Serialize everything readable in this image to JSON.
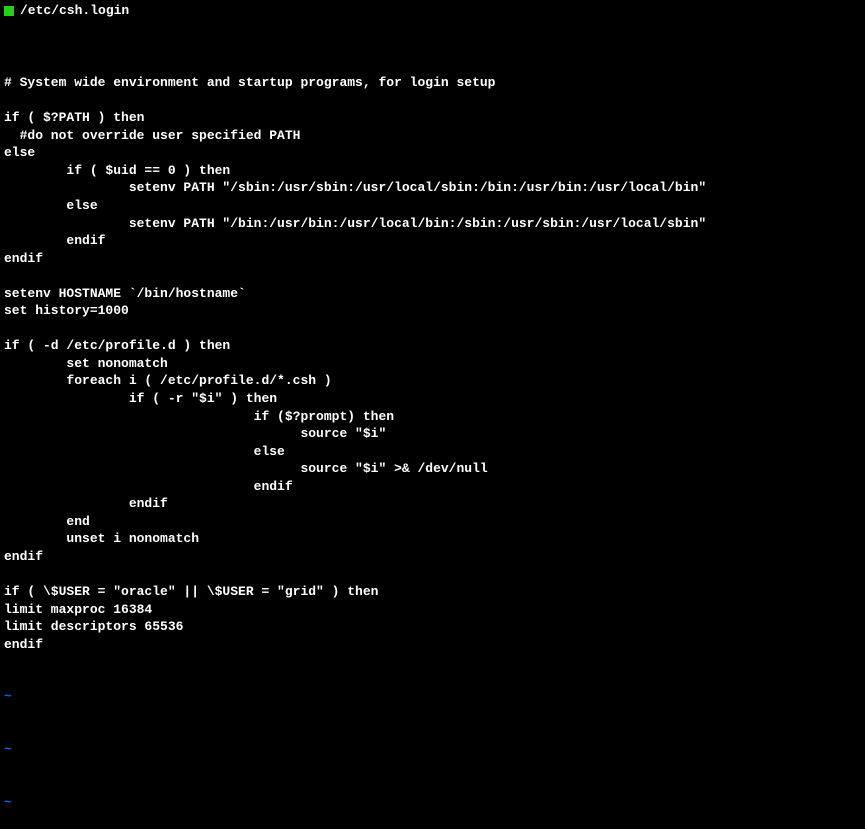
{
  "titlebar": {
    "filename": "/etc/csh.login"
  },
  "editor": {
    "lines": [
      "",
      "# System wide environment and startup programs, for login setup",
      "",
      "if ( $?PATH ) then",
      "  #do not override user specified PATH",
      "else",
      "        if ( $uid == 0 ) then",
      "                setenv PATH \"/sbin:/usr/sbin:/usr/local/sbin:/bin:/usr/bin:/usr/local/bin\"",
      "        else",
      "                setenv PATH \"/bin:/usr/bin:/usr/local/bin:/sbin:/usr/sbin:/usr/local/sbin\"",
      "        endif",
      "endif",
      "",
      "setenv HOSTNAME `/bin/hostname`",
      "set history=1000",
      "",
      "if ( -d /etc/profile.d ) then",
      "        set nonomatch",
      "        foreach i ( /etc/profile.d/*.csh )",
      "                if ( -r \"$i\" ) then",
      "                                if ($?prompt) then",
      "                                      source \"$i\"",
      "                                else",
      "                                      source \"$i\" >& /dev/null",
      "                                endif",
      "                endif",
      "        end",
      "        unset i nonomatch",
      "endif",
      "",
      "if ( \\$USER = \"oracle\" || \\$USER = \"grid\" ) then",
      "limit maxproc 16384",
      "limit descriptors 65536",
      "endif"
    ]
  },
  "tilde": "~"
}
